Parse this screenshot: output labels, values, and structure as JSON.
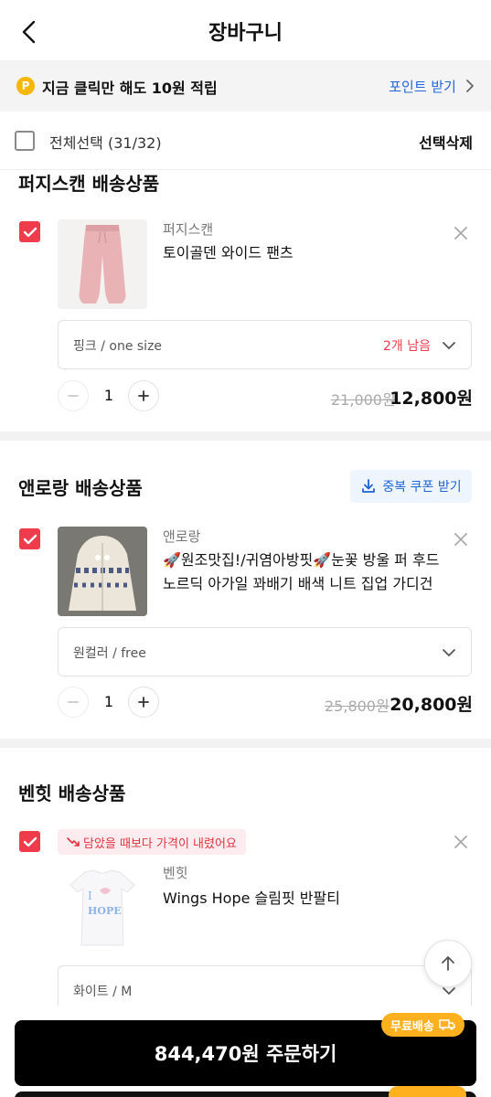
{
  "header": {
    "title": "장바구니",
    "back_icon": "chevron-left-icon"
  },
  "point_bar": {
    "coin_label": "P",
    "text": "지금 클릭만 해도 10원 적립",
    "link_label": "포인트 받기"
  },
  "select_bar": {
    "select_all_label": "전체선택 (31/32)",
    "delete_label": "선택삭제"
  },
  "groups": [
    {
      "seller_title": "퍼지스캔 배송상품",
      "item": {
        "brand": "퍼지스캔",
        "name": "토이골덴 와이드 팬츠",
        "option": "핑크 / one size",
        "stock": "2개 남음",
        "qty": "1",
        "original_price": "21,000원",
        "sale_price": "12,800원"
      }
    },
    {
      "seller_title": "앤로랑 배송상품",
      "coupon_label": "중복 쿠폰 받기",
      "item": {
        "brand": "앤로랑",
        "name": "🚀원조맛집!/귀염아방핏🚀눈꽃 방울 퍼 후드 노르딕 아가일 꽈배기 배색 니트 집업 가디건",
        "option": "원컬러 / free",
        "qty": "1",
        "original_price": "25,800원",
        "sale_price": "20,800원"
      }
    },
    {
      "seller_title": "벤힛 배송상품",
      "item": {
        "badge": "담았을 때보다 가격이 내렸어요",
        "brand": "벤힛",
        "name": "Wings Hope 슬림핏 반팔티",
        "option": "화이트 / M"
      }
    }
  ],
  "bottom": {
    "order_label": "844,470원 주문하기",
    "free_shipping_label": "무료배송"
  },
  "colors": {
    "accent_red": "#ee3c4d",
    "link_blue": "#2167d8",
    "badge_orange": "#ffb01f",
    "coin_yellow": "#f5b700"
  }
}
